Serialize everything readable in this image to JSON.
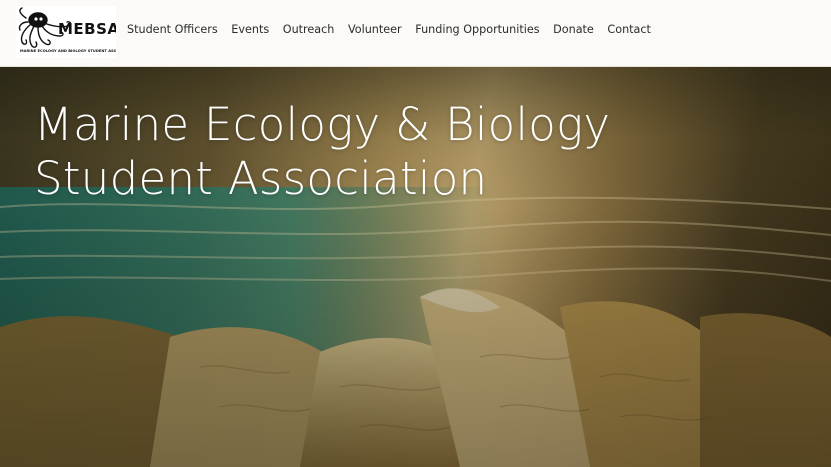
{
  "logo": {
    "name": "MEBSA",
    "subtitle": "MARINE ECOLOGY AND BIOLOGY STUDENT ASSOCIATION",
    "icon": "octopus-icon"
  },
  "nav": {
    "items": [
      {
        "label": "Student Officers"
      },
      {
        "label": "Events"
      },
      {
        "label": "Outreach"
      },
      {
        "label": "Volunteer"
      },
      {
        "label": "Funding Opportunities"
      },
      {
        "label": "Donate"
      },
      {
        "label": "Contact"
      }
    ]
  },
  "hero": {
    "title_line1": "Marine Ecology & Biology",
    "title_line2": "Student Association"
  },
  "colors": {
    "header_bg": "#fbfaf6",
    "nav_text": "#2c2c2c",
    "hero_text": "#ffffff"
  }
}
